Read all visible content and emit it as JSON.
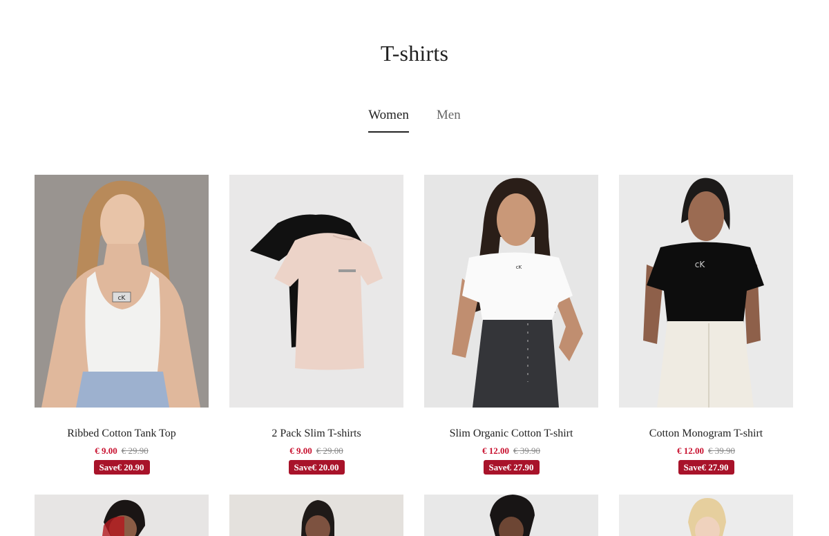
{
  "page": {
    "title": "T-shirts"
  },
  "tabs": [
    {
      "label": "Women",
      "active": true
    },
    {
      "label": "Men",
      "active": false
    }
  ],
  "products": [
    {
      "name": "Ribbed Cotton Tank Top",
      "price": "€ 9.00",
      "original_price": "€ 29.90",
      "save": "Save€ 20.90"
    },
    {
      "name": "2 Pack Slim T-shirts",
      "price": "€ 9.00",
      "original_price": "€ 29.00",
      "save": "Save€ 20.00"
    },
    {
      "name": "Slim Organic Cotton T-shirt",
      "price": "€ 12.00",
      "original_price": "€ 39.90",
      "save": "Save€ 27.90"
    },
    {
      "name": "Cotton Monogram T-shirt",
      "price": "€ 12.00",
      "original_price": "€ 39.90",
      "save": "Save€ 27.90"
    }
  ],
  "colors": {
    "sale_price": "#c8102e",
    "save_badge": "#a8132a",
    "text": "#222222",
    "muted": "#888888"
  }
}
